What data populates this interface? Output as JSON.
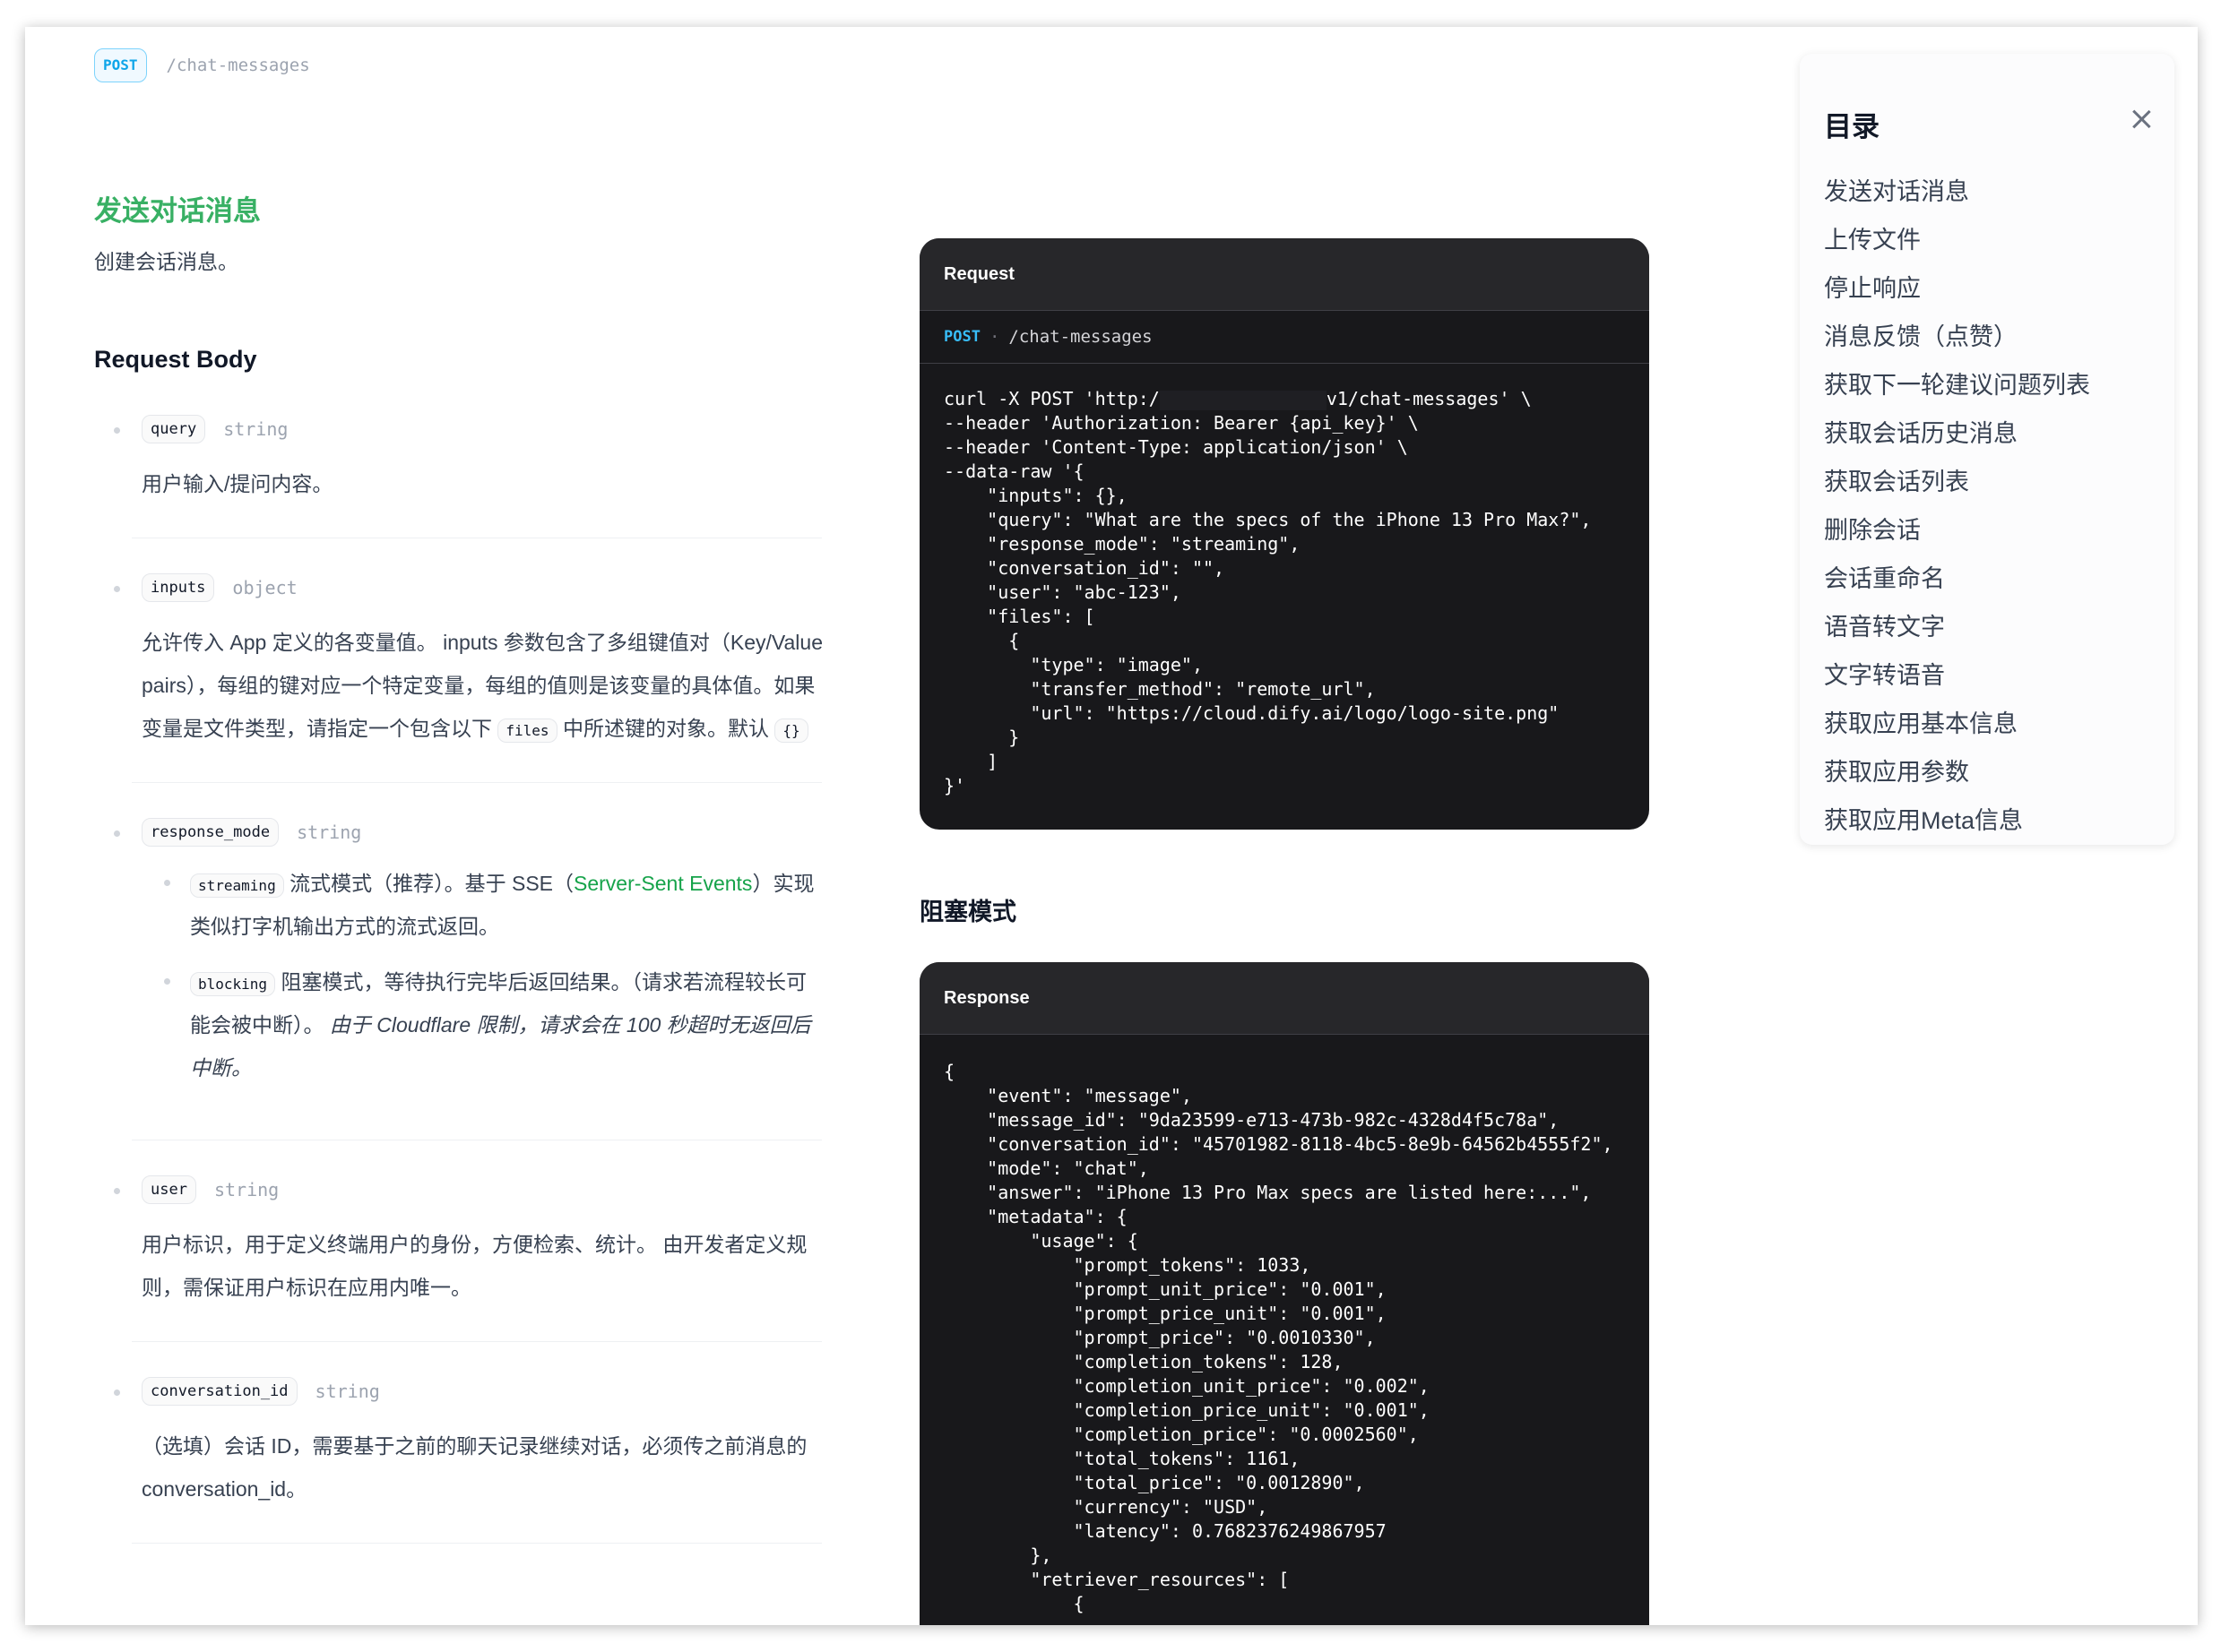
{
  "header": {
    "method": "POST",
    "path": "/chat-messages"
  },
  "title": "发送对话消息",
  "description": "创建会话消息。",
  "section_title": "Request Body",
  "params": {
    "query": {
      "name": "query",
      "type": "string",
      "desc": "用户输入/提问内容。"
    },
    "inputs": {
      "name": "inputs",
      "type": "object",
      "desc_1": "允许传入 App 定义的各变量值。 inputs 参数包含了多组键值对（Key/Value pairs），每组的键对应一个特定变量，每组的值则是该变量的具体值。如果变量是文件类型，请指定一个包含以下",
      "chip_files": "files",
      "desc_2": "中所述键的对象。默认",
      "chip_default": "{}"
    },
    "response_mode": {
      "name": "response_mode",
      "type": "string",
      "streaming_chip": "streaming",
      "streaming_text_1": "流式模式（推荐）。基于 SSE（",
      "streaming_link": "Server-Sent Events",
      "streaming_text_2": "）实现类似打字机输出方式的流式返回。",
      "blocking_chip": "blocking",
      "blocking_text": "阻塞模式，等待执行完毕后返回结果。（请求若流程较长可能会被中断）。",
      "blocking_em": "由于 Cloudflare 限制，请求会在 100 秒超时无返回后中断。"
    },
    "user": {
      "name": "user",
      "type": "string",
      "desc": "用户标识，用于定义终端用户的身份，方便检索、统计。 由开发者定义规则，需保证用户标识在应用内唯一。"
    },
    "conversation_id": {
      "name": "conversation_id",
      "type": "string",
      "desc": "（选填）会话 ID，需要基于之前的聊天记录继续对话，必须传之前消息的 conversation_id。"
    }
  },
  "request_panel": {
    "title": "Request",
    "method": "POST",
    "separator": "·",
    "path": "/chat-messages",
    "line1_prefix": "curl -X POST 'http:/",
    "line1_suffix": "v1/chat-messages' \\",
    "code_rest": "--header 'Authorization: Bearer {api_key}' \\\n--header 'Content-Type: application/json' \\\n--data-raw '{\n    \"inputs\": {},\n    \"query\": \"What are the specs of the iPhone 13 Pro Max?\",\n    \"response_mode\": \"streaming\",\n    \"conversation_id\": \"\",\n    \"user\": \"abc-123\",\n    \"files\": [\n      {\n        \"type\": \"image\",\n        \"transfer_method\": \"remote_url\",\n        \"url\": \"https://cloud.dify.ai/logo/logo-site.png\"\n      }\n    ]\n}'"
  },
  "blocking_title": "阻塞模式",
  "response_panel": {
    "title": "Response",
    "code": "{\n    \"event\": \"message\",\n    \"message_id\": \"9da23599-e713-473b-982c-4328d4f5c78a\",\n    \"conversation_id\": \"45701982-8118-4bc5-8e9b-64562b4555f2\",\n    \"mode\": \"chat\",\n    \"answer\": \"iPhone 13 Pro Max specs are listed here:...\",\n    \"metadata\": {\n        \"usage\": {\n            \"prompt_tokens\": 1033,\n            \"prompt_unit_price\": \"0.001\",\n            \"prompt_price_unit\": \"0.001\",\n            \"prompt_price\": \"0.0010330\",\n            \"completion_tokens\": 128,\n            \"completion_unit_price\": \"0.002\",\n            \"completion_price_unit\": \"0.001\",\n            \"completion_price\": \"0.0002560\",\n            \"total_tokens\": 1161,\n            \"total_price\": \"0.0012890\",\n            \"currency\": \"USD\",\n            \"latency\": 0.7682376249867957\n        },\n        \"retriever_resources\": [\n            {"
  },
  "toc": {
    "title": "目录",
    "items": [
      "发送对话消息",
      "上传文件",
      "停止响应",
      "消息反馈（点赞）",
      "获取下一轮建议问题列表",
      "获取会话历史消息",
      "获取会话列表",
      "删除会话",
      "会话重命名",
      "语音转文字",
      "文字转语音",
      "获取应用基本信息",
      "获取应用参数",
      "获取应用Meta信息"
    ]
  }
}
